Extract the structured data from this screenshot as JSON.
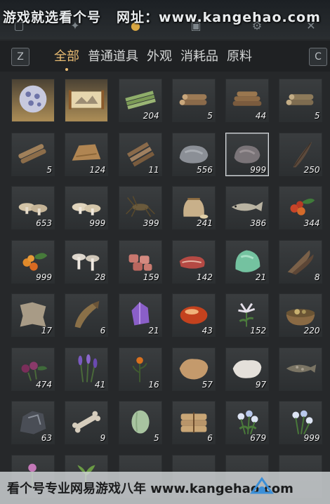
{
  "watermark_top": {
    "text": "游戏就选看个号",
    "site": "网址：www.kangehao.com"
  },
  "tabs": {
    "left_key": "Z",
    "right_key": "C",
    "items": [
      {
        "label": "全部"
      },
      {
        "label": "普通道具"
      },
      {
        "label": "外观"
      },
      {
        "label": "消耗品"
      },
      {
        "label": "原料"
      }
    ]
  },
  "inventory": [
    {
      "icon": "crystal-orb",
      "count": ""
    },
    {
      "icon": "scroll-painting",
      "count": ""
    },
    {
      "icon": "bamboo-bundle",
      "count": "204"
    },
    {
      "icon": "log-pile",
      "count": "5"
    },
    {
      "icon": "firewood-pile",
      "count": "44"
    },
    {
      "icon": "log-pile-green",
      "count": "5"
    },
    {
      "icon": "log-bundle",
      "count": "5"
    },
    {
      "icon": "straw-bundle",
      "count": "124"
    },
    {
      "icon": "wood-planks",
      "count": "11"
    },
    {
      "icon": "rock",
      "count": "556"
    },
    {
      "icon": "rock-dark",
      "count": "999"
    },
    {
      "icon": "dark-feather",
      "count": "250"
    },
    {
      "icon": "mushrooms-beige",
      "count": "653"
    },
    {
      "icon": "mushrooms-pale",
      "count": "999"
    },
    {
      "icon": "cricket",
      "count": "399"
    },
    {
      "icon": "grain-sack",
      "count": "241"
    },
    {
      "icon": "fish",
      "count": "386"
    },
    {
      "icon": "red-berries",
      "count": "344"
    },
    {
      "icon": "orange-berries",
      "count": "999"
    },
    {
      "icon": "white-mushrooms",
      "count": "28"
    },
    {
      "icon": "raw-meat",
      "count": "159"
    },
    {
      "icon": "meat-slices",
      "count": "142"
    },
    {
      "icon": "jade-stone",
      "count": "21"
    },
    {
      "icon": "feathers-bundle",
      "count": "8"
    },
    {
      "icon": "animal-hide",
      "count": "17"
    },
    {
      "icon": "carp",
      "count": "6"
    },
    {
      "icon": "purple-crystal",
      "count": "21"
    },
    {
      "icon": "amber-stone",
      "count": "43"
    },
    {
      "icon": "white-flower",
      "count": "152"
    },
    {
      "icon": "herb-bowl",
      "count": "220"
    },
    {
      "icon": "purple-flowers",
      "count": "474"
    },
    {
      "icon": "lavender",
      "count": "41"
    },
    {
      "icon": "orange-flower",
      "count": "16"
    },
    {
      "icon": "fur-pelt",
      "count": "57"
    },
    {
      "icon": "white-fur",
      "count": "97"
    },
    {
      "icon": "speckled-fish",
      "count": ""
    },
    {
      "icon": "dark-ore",
      "count": "63"
    },
    {
      "icon": "bone",
      "count": "9"
    },
    {
      "icon": "melon",
      "count": "5"
    },
    {
      "icon": "cloth-bundle",
      "count": "6"
    },
    {
      "icon": "blue-white-flowers",
      "count": "679"
    },
    {
      "icon": "blue-white-flowers-2",
      "count": "999"
    },
    {
      "icon": "pink-flower",
      "count": ""
    },
    {
      "icon": "green-sprout",
      "count": ""
    },
    {
      "icon": "empty",
      "count": ""
    },
    {
      "icon": "empty",
      "count": ""
    },
    {
      "icon": "empty",
      "count": ""
    },
    {
      "icon": "empty",
      "count": ""
    }
  ],
  "watermark_bottom": {
    "text": "看个号专业网易游戏八年  www.kangehao.com"
  }
}
